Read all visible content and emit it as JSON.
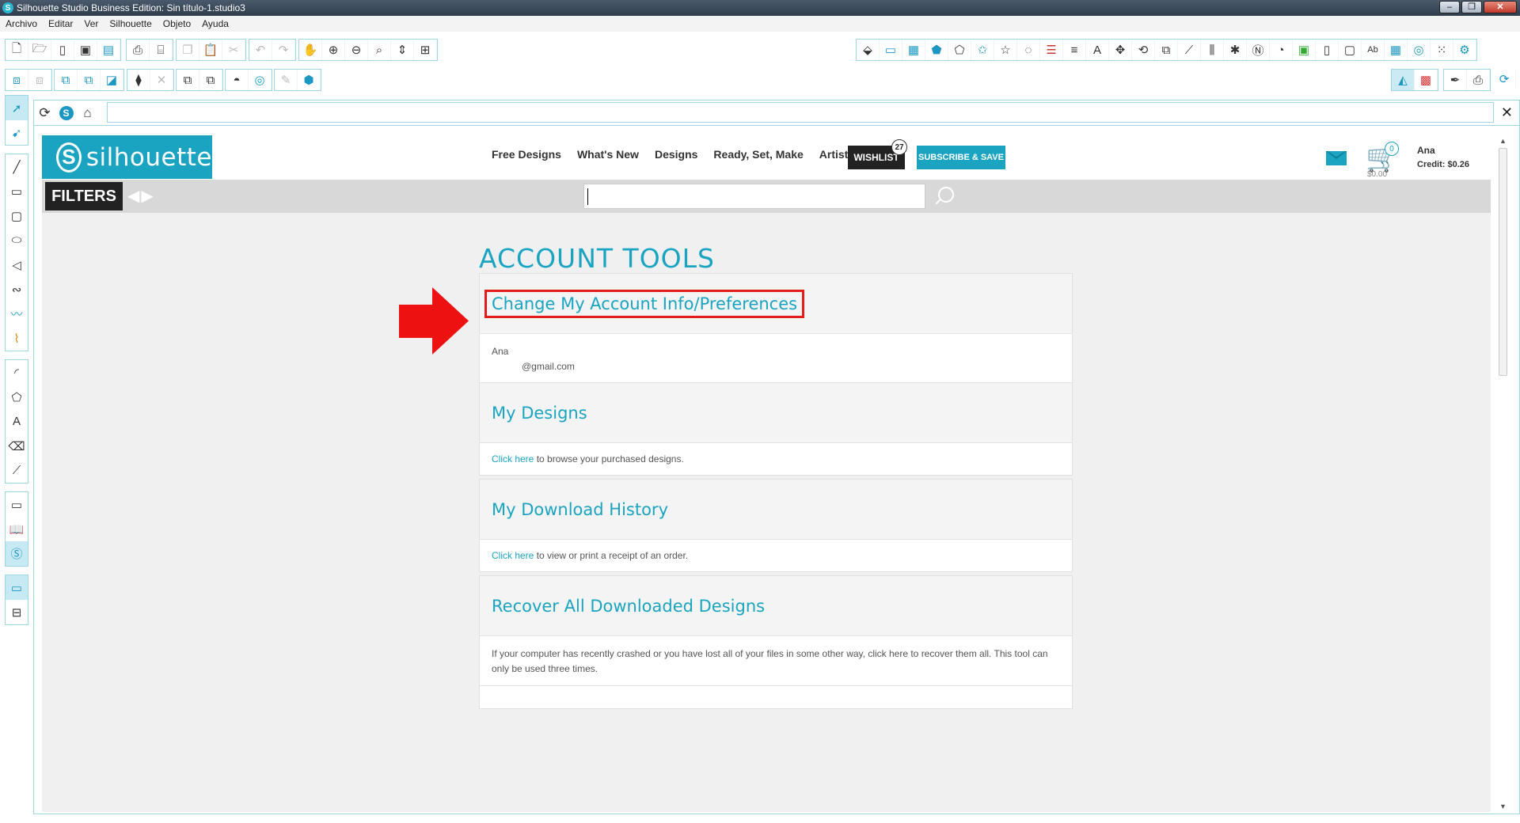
{
  "window": {
    "title": "Silhouette Studio Business Edition: Sin título-1.studio3",
    "controls": [
      "minimize",
      "restore",
      "close"
    ]
  },
  "menubar": {
    "items": [
      "Archivo",
      "Editar",
      "Ver",
      "Silhouette",
      "Objeto",
      "Ayuda"
    ]
  },
  "toolbar_icons": {
    "row1_left": [
      "new-document-icon",
      "open-folder-icon",
      "new-page-icon",
      "save-icon",
      "save-library-icon",
      "print-icon",
      "print-preview-icon",
      "copy-icon",
      "paste-icon",
      "cut-icon",
      "undo-icon",
      "redo-icon",
      "pan-hand-icon",
      "zoom-in-icon",
      "zoom-out-icon",
      "zoom-select-icon",
      "zoom-drag-icon",
      "fit-page-icon"
    ],
    "row1_right": [
      "fill-icon",
      "page-settings-icon",
      "grid-icon",
      "pentagon-fill-icon",
      "pentagon-outline-icon",
      "star-icon",
      "star-outline-icon",
      "shape-icon",
      "line-color-icon",
      "line-style-icon",
      "text-icon",
      "transform-icon",
      "rotate-icon",
      "scale-icon",
      "knife-icon",
      "align-icon",
      "replicate-icon",
      "nest-icon",
      "offset-icon",
      "trace-icon",
      "portrait-icon",
      "frame-icon",
      "text-style-icon",
      "grid-settings-icon",
      "spiral-icon",
      "dots-icon",
      "settings-icon"
    ],
    "row2_left": [
      "group-icon",
      "ungroup-icon",
      "compound-icon",
      "release-compound-icon",
      "bring-front-icon",
      "send-back-icon",
      "weld-icon",
      "delete-icon",
      "duplicate-icon",
      "mirror-icon",
      "modify-icon",
      "eraser-icon",
      "offset-ring-icon",
      "brush-icon",
      "cube-icon"
    ],
    "row2_right": [
      "design-view-icon",
      "pattern-icon",
      "stylus-icon",
      "send-to-silhouette-icon",
      "refresh-sync-icon"
    ]
  },
  "left_tools": [
    "select-arrow-icon",
    "point-edit-icon",
    "line-icon",
    "rectangle-icon",
    "rounded-rect-icon",
    "ellipse-icon",
    "polygon-icon",
    "curve-icon",
    "freehand-icon",
    "smooth-freehand-icon",
    "arc-icon",
    "regular-polygon-icon",
    "text-tool-icon",
    "eraser-tool-icon",
    "knife-tool-icon",
    "design-page-icon",
    "library-icon",
    "silhouette-store-icon",
    "single-view-icon",
    "split-view-icon"
  ],
  "browser": {
    "url": "",
    "close_label": "✕"
  },
  "site": {
    "logo_text": "silhouette",
    "nav": [
      "Free Designs",
      "What's New",
      "Designs",
      "Ready, Set, Make",
      "Artists"
    ],
    "wishlist_label": "WISHLIST",
    "wishlist_count": "27",
    "subscribe_label": "SUBSCRIBE & SAVE",
    "cart_count": "0",
    "cart_total": "$0.00",
    "user_name": "Ana",
    "user_credit": "Credit: $0.26",
    "filters_label": "FILTERS",
    "search_placeholder": ""
  },
  "account": {
    "heading": "ACCOUNT TOOLS",
    "cards": [
      {
        "title": "Change My Account Info/Preferences",
        "line1": "Ana",
        "line2": "@gmail.com"
      },
      {
        "title": "My Designs",
        "link": "Click here",
        "text": " to browse your purchased designs."
      },
      {
        "title": "My Download History",
        "link": "Click here",
        "text": " to view or print a receipt of an order."
      },
      {
        "title": "Recover All Downloaded Designs",
        "text": "If your computer has recently crashed or you have lost all of your files in some other way, click here to recover them all. This tool can only be used three times."
      }
    ]
  },
  "colors": {
    "brand": "#1aa4c1",
    "highlight": "#e31b1b",
    "arrow": "#ee1111",
    "toolbar_border": "#9fd6e3"
  }
}
